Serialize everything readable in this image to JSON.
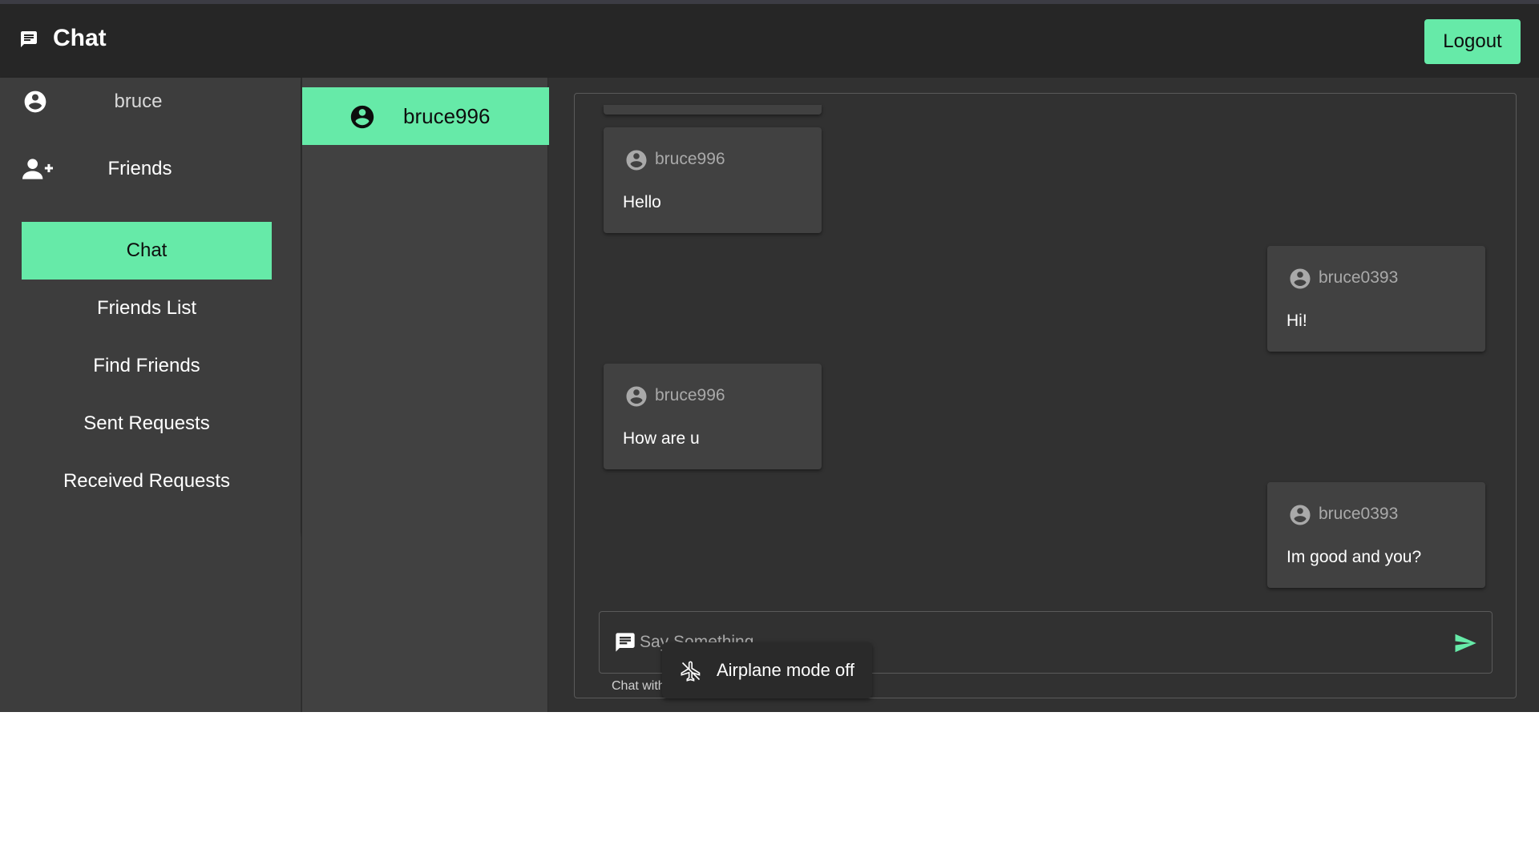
{
  "header": {
    "title": "Chat",
    "logout_label": "Logout"
  },
  "nav": {
    "username": "bruce",
    "friends_label": "Friends",
    "items": [
      {
        "label": "Chat",
        "active": true
      },
      {
        "label": "Friends List",
        "active": false
      },
      {
        "label": "Find Friends",
        "active": false
      },
      {
        "label": "Sent Requests",
        "active": false
      },
      {
        "label": "Received Requests",
        "active": false
      }
    ]
  },
  "conversations": [
    {
      "name": "bruce996",
      "selected": true
    }
  ],
  "messages": [
    {
      "author": "bruce996",
      "text": "Hello",
      "side": "left"
    },
    {
      "author": "bruce0393",
      "text": "Hi!",
      "side": "right"
    },
    {
      "author": "bruce996",
      "text": "How are u",
      "side": "left"
    },
    {
      "author": "bruce0393",
      "text": "Im good and you?",
      "side": "right"
    }
  ],
  "composer": {
    "placeholder": "Say Something",
    "value": "",
    "helper": "Chat with"
  },
  "toast": {
    "text": "Airplane mode off",
    "icon": "airplane-icon"
  },
  "colors": {
    "accent": "#66eaa8",
    "header_bg": "#262626",
    "panel_bg": "#3d3d3d",
    "chat_bg": "#313131"
  }
}
